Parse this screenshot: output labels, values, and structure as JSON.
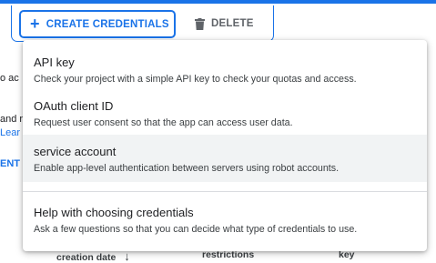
{
  "toolbar": {
    "create_label": "CREATE CREDENTIALS",
    "create_icon": "+",
    "delete_label": "DELETE"
  },
  "background": {
    "line1": "o ac",
    "line2": "and r",
    "line3": "Lear",
    "line4": "ENT",
    "columns": [
      "creation date",
      "restrictions",
      "key"
    ]
  },
  "menu": {
    "items": [
      {
        "title": "API key",
        "description": "Check your project with a simple API key to check your quotas and access."
      },
      {
        "title": "OAuth client ID",
        "description": "Request user consent so that the app can access user data."
      },
      {
        "title": "service account",
        "description": "Enable app-level authentication between servers using robot accounts."
      },
      {
        "title": "Help with choosing credentials",
        "description": "Ask a few questions so that you can decide what type of credentials to use."
      }
    ]
  },
  "colors": {
    "accent": "#1a73e8",
    "highlight": "#f1f3f4",
    "text": "#202124"
  }
}
